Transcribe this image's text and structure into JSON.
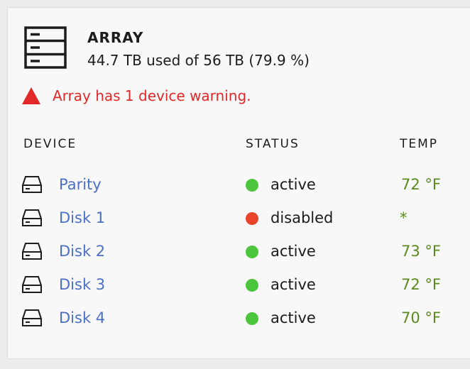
{
  "array": {
    "title": "ARRAY",
    "usage": "44.7 TB used of 56 TB (79.9 %)",
    "warning": "Array has 1 device warning.",
    "icon": "server-icon"
  },
  "table": {
    "headers": {
      "device": "DEVICE",
      "status": "STATUS",
      "temp": "TEMP"
    },
    "rows": [
      {
        "device": "Parity",
        "status": "active",
        "status_color": "#4cc43c",
        "temp": "72 °F"
      },
      {
        "device": "Disk 1",
        "status": "disabled",
        "status_color": "#e8442a",
        "temp": "*"
      },
      {
        "device": "Disk 2",
        "status": "active",
        "status_color": "#4cc43c",
        "temp": "73 °F"
      },
      {
        "device": "Disk 3",
        "status": "active",
        "status_color": "#4cc43c",
        "temp": "72 °F"
      },
      {
        "device": "Disk 4",
        "status": "active",
        "status_color": "#4cc43c",
        "temp": "70 °F"
      }
    ]
  },
  "colors": {
    "link": "#4a6fc4",
    "warning": "#e22828",
    "temp": "#5a8a1e",
    "active": "#4cc43c",
    "disabled": "#e8442a"
  }
}
